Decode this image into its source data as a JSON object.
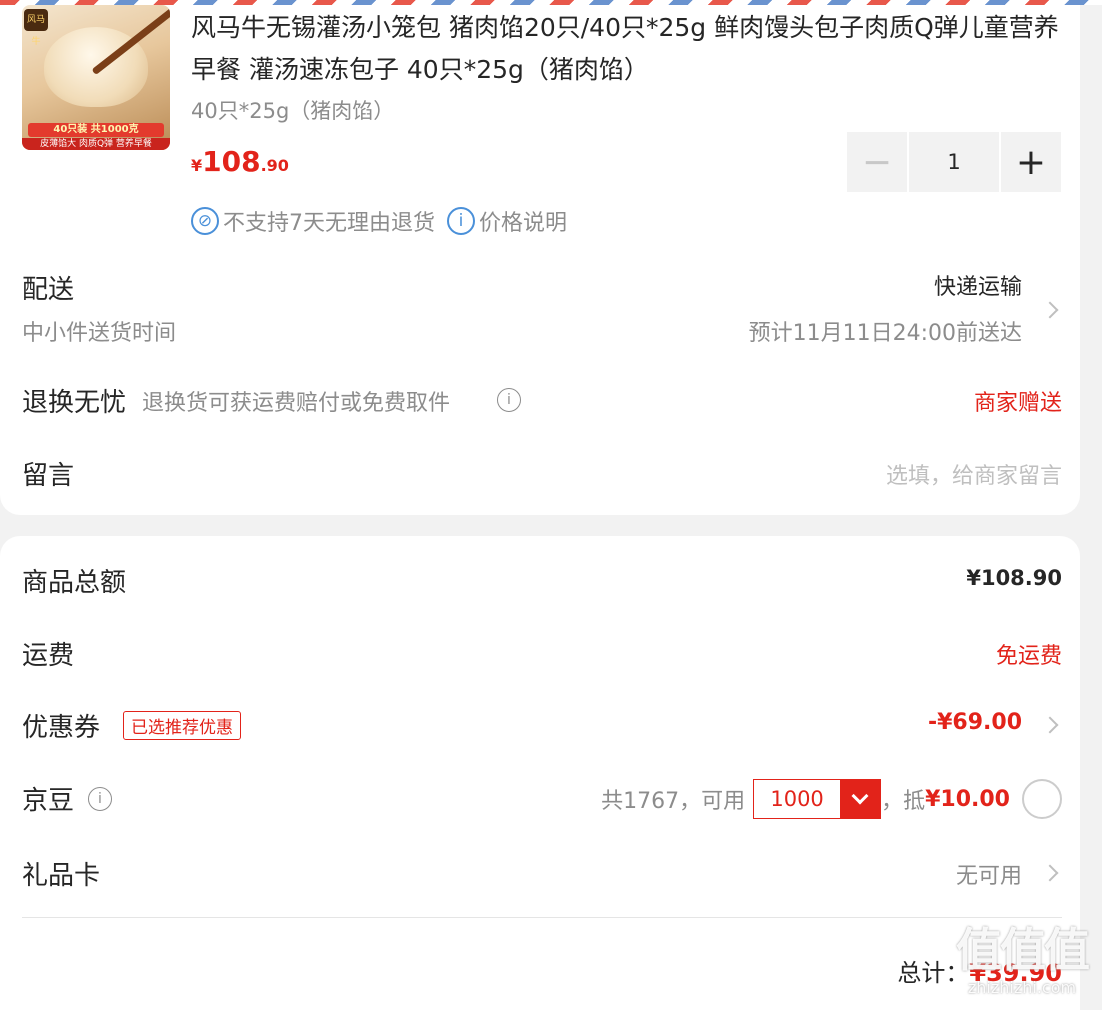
{
  "product": {
    "title": "风马牛无锡灌汤小笼包 猪肉馅20只/40只*25g 鲜肉馒头包子肉质Q弹儿童营养早餐 灌汤速冻包子 40只*25g（猪肉馅）",
    "spec": "40只*25g（猪肉馅）",
    "price_symbol": "¥",
    "price_int": "108",
    "price_dec": ".90",
    "quantity": "1",
    "no_return_text": "不支持7天无理由退货",
    "price_note_text": "价格说明",
    "image": {
      "logo_text": "风马牛",
      "band_text": "40只装 共1000克",
      "bottom_text": "皮薄馅大 肉质Q弹 营养早餐"
    }
  },
  "delivery": {
    "label": "配送",
    "method": "快递运输",
    "sub_label": "中小件送货时间",
    "eta": "预计11月11日24:00前送达"
  },
  "returns": {
    "label": "退换无忧",
    "desc": "退换货可获运费赔付或免费取件",
    "value": "商家赠送"
  },
  "message": {
    "label": "留言",
    "placeholder": "选填，给商家留言"
  },
  "summary": {
    "goods_total_label": "商品总额",
    "goods_total": "¥108.90",
    "shipping_label": "运费",
    "shipping_value": "免运费",
    "coupon_label": "优惠券",
    "coupon_tag": "已选推荐优惠",
    "coupon_value": "-¥69.00",
    "beans_label": "京豆",
    "beans_total": "共1767，可用",
    "beans_selected": "1000",
    "beans_deduct_prefix": "，抵",
    "beans_deduct_value": "¥10.00",
    "giftcard_label": "礼品卡",
    "giftcard_value": "无可用",
    "total_label": "总计：",
    "total_value": "¥39.90"
  },
  "watermark": {
    "big": "值值值",
    "small": "zhizhizhi.com"
  }
}
